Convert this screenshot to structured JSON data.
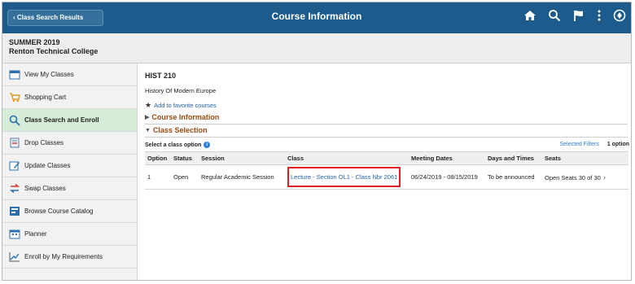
{
  "topbar": {
    "back_label": "Class Search Results",
    "title": "Course Information",
    "colors": {
      "bar": "#1c5b8b"
    },
    "icons": [
      "home-icon",
      "search-icon",
      "flag-icon",
      "more-icon",
      "nav-icon"
    ]
  },
  "term": {
    "name": "SUMMER 2019",
    "college": "Renton Technical College"
  },
  "sidebar": {
    "items": [
      {
        "label": "View My Classes",
        "icon": "calendar-icon"
      },
      {
        "label": "Shopping Cart",
        "icon": "cart-icon"
      },
      {
        "label": "Class Search and Enroll",
        "icon": "search-icon",
        "active": true
      },
      {
        "label": "Drop Classes",
        "icon": "drop-icon"
      },
      {
        "label": "Update Classes",
        "icon": "edit-icon"
      },
      {
        "label": "Swap Classes",
        "icon": "swap-icon"
      },
      {
        "label": "Browse Course Catalog",
        "icon": "catalog-icon"
      },
      {
        "label": "Planner",
        "icon": "planner-icon"
      },
      {
        "label": "Enroll by My Requirements",
        "icon": "chart-icon"
      }
    ],
    "active_color": "#d4ecd8"
  },
  "course": {
    "code": "HIST 210",
    "name": "History Of Modern Europe",
    "favorite_label": "Add to favorite courses"
  },
  "sections": {
    "info_label": "Course Information",
    "selection_label": "Class Selection"
  },
  "selection": {
    "prompt": "Select a class option",
    "filters_link": "Selected Filters",
    "option_count": "1 option"
  },
  "table": {
    "headers": [
      "Option",
      "Status",
      "Session",
      "Class",
      "Meeting Dates",
      "Days and Times",
      "Seats"
    ],
    "rows": [
      {
        "option": "1",
        "status": "Open",
        "session": "Regular Academic Session",
        "class": "Lecture - Section OL1 - Class Nbr 2061",
        "meeting_dates": "06/24/2019 - 08/15/2019",
        "days_times": "To be announced",
        "seats": "Open Seats 30 of 30"
      }
    ],
    "highlight_color": "#e01e1e"
  }
}
